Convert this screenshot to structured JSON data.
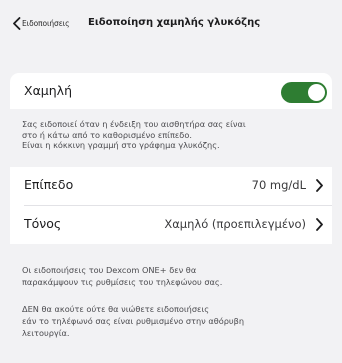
{
  "nav": {
    "back_label": "Ειδοποιήσεις",
    "title": "Ειδοποίηση χαμηλής γλυκόζης"
  },
  "low_alert": {
    "label": "Χαμηλή",
    "toggle_on": true,
    "toggle_color": "#2e7d32"
  },
  "description": {
    "line1": "Σας ειδοποιεί όταν η ένδειξη του αισθητήρα σας είναι",
    "line2": "στο ή κάτω από το καθορισμένο επίπεδο.",
    "line3": "Είναι η κόκκινη γραμμή στο γράφημα γλυκόζης."
  },
  "settings": {
    "level_label": "Επίπεδο",
    "level_value": "70 mg/dL",
    "tone_label": "Τόνος",
    "tone_value": "Χαμηλό (προεπιλεγμένο)"
  },
  "footer": {
    "note1_line1": "Οι ειδοποιήσεις του Dexcom ONE+ δεν θα",
    "note1_line2": "παρακάμψουν τις ρυθμίσεις του τηλεφώνου σας.",
    "note2_line1": "ΔΕΝ θα ακούτε ούτε θα νιώθετε ειδοποιήσεις",
    "note2_line2": "εάν το τηλέφωνό σας είναι ρυθμισμένο στην αθόρυβη",
    "note2_line3": "λειτουργία."
  }
}
